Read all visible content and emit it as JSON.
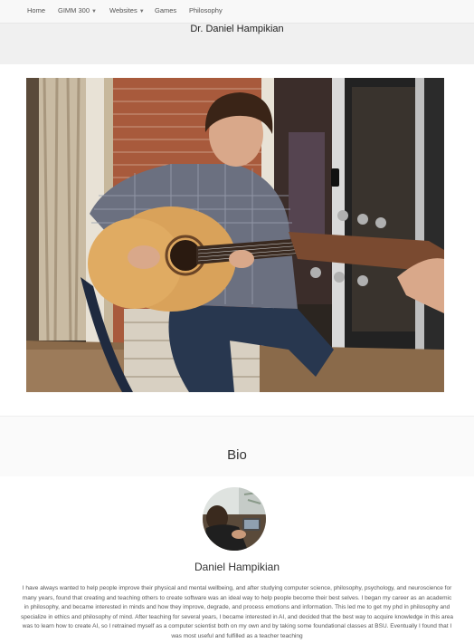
{
  "nav": {
    "items": [
      {
        "label": "Home",
        "has_caret": false
      },
      {
        "label": "GIMM 300",
        "has_caret": true
      },
      {
        "label": "Websites",
        "has_caret": true
      },
      {
        "label": "Games",
        "has_caret": false
      },
      {
        "label": "Philosophy",
        "has_caret": false
      }
    ]
  },
  "header": {
    "title": "Dr. Daniel Hampikian"
  },
  "bio": {
    "heading": "Bio",
    "name": "Daniel Hampikian",
    "text": "I have always wanted to help people improve their physical and mental wellbeing, and after studying computer science, philosophy, psychology, and neuroscience for many years, found that creating and teaching others to create software was an ideal way to help people become their best selves. I began my career as an academic in philosophy, and became interested in minds and how they improve, degrade, and process emotions and information. This led me to get my phd in philosophy and specialize in ethics and philosophy of mind. After teaching for several years, I became interested in AI, and decided that the best way to acquire knowledge in this area was to learn how to create AI, so I retrained myself as a computer scientist both on my own and by taking some foundational classes at BSU. Eventually I found that I was most useful and fulfilled as a teacher teaching"
  },
  "colors": {
    "navbar_bg": "#f8f8f8",
    "header_bg": "#f0f0f0",
    "text": "#333333"
  }
}
